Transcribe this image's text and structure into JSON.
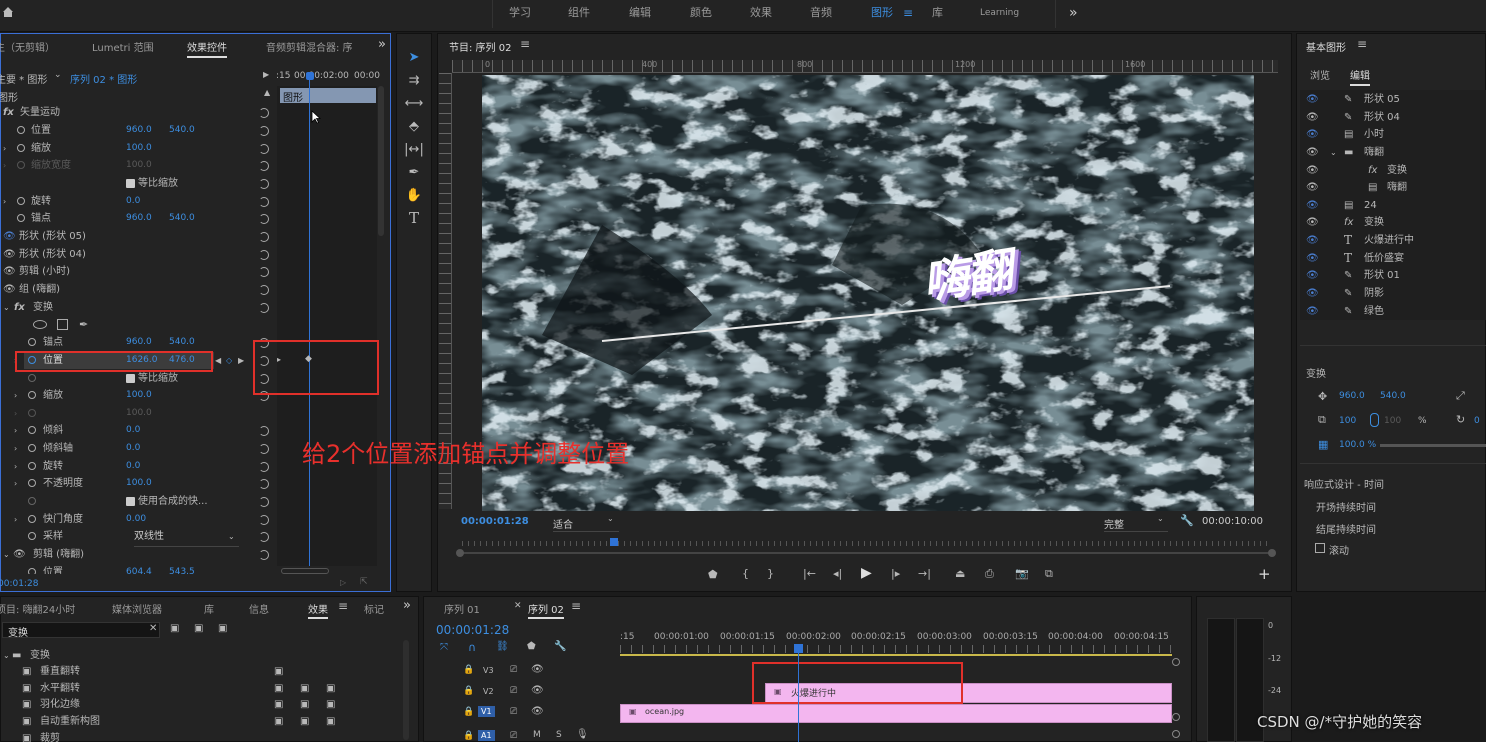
{
  "workspaces": {
    "items": [
      "学习",
      "组件",
      "编辑",
      "颜色",
      "效果",
      "音频",
      "图形",
      "库",
      "Learning"
    ],
    "active": "图形",
    "menu_icon": "hamburger-icon",
    "more": "»"
  },
  "effect_controls": {
    "tabs": [
      "主（无剪辑）",
      "Lumetri 范围",
      "效果控件",
      "音频剪辑混合器: 序"
    ],
    "active_tab": "效果控件",
    "source_label": "主要 * 图形",
    "sequence_label": "序列 02 * 图形",
    "timecode_start": ":15",
    "timecode_mid": "00:00:02:00",
    "timecode_end": "00:00",
    "clip_label": "图形",
    "section_label": "图形",
    "rows": [
      {
        "label": "矢量运动",
        "v1": "",
        "v2": ""
      },
      {
        "label": "位置",
        "v1": "960.0",
        "v2": "540.0"
      },
      {
        "label": "缩放",
        "v1": "100.0",
        "v2": ""
      },
      {
        "label": "缩放宽度",
        "v1": "100.0",
        "v2": ""
      },
      {
        "label": "等比缩放",
        "v1": "",
        "v2": ""
      },
      {
        "label": "旋转",
        "v1": "0.0",
        "v2": ""
      },
      {
        "label": "锚点",
        "v1": "960.0",
        "v2": "540.0"
      },
      {
        "label": "形状 (形状 05)",
        "v1": "",
        "v2": ""
      },
      {
        "label": "形状 (形状 04)",
        "v1": "",
        "v2": ""
      },
      {
        "label": "剪辑 (小时)",
        "v1": "",
        "v2": ""
      },
      {
        "label": "组 (嗨翻)",
        "v1": "",
        "v2": ""
      },
      {
        "label": "变换",
        "v1": "",
        "v2": ""
      },
      {
        "label": "",
        "v1": "",
        "v2": ""
      },
      {
        "label": "锚点",
        "v1": "960.0",
        "v2": "540.0"
      },
      {
        "label": "位置",
        "v1": "1626.0",
        "v2": "476.0"
      },
      {
        "label": "等比缩放",
        "v1": "",
        "v2": ""
      },
      {
        "label": "缩放",
        "v1": "100.0",
        "v2": ""
      },
      {
        "label": "",
        "v1": "100.0",
        "v2": ""
      },
      {
        "label": "倾斜",
        "v1": "0.0",
        "v2": ""
      },
      {
        "label": "倾斜轴",
        "v1": "0.0",
        "v2": ""
      },
      {
        "label": "旋转",
        "v1": "0.0",
        "v2": ""
      },
      {
        "label": "不透明度",
        "v1": "100.0",
        "v2": ""
      },
      {
        "label": "使用合成的快...",
        "v1": "",
        "v2": ""
      },
      {
        "label": "快门角度",
        "v1": "0.00",
        "v2": ""
      },
      {
        "label": "采样",
        "v1": "双线性",
        "v2": ""
      },
      {
        "label": "剪辑 (嗨翻)",
        "v1": "",
        "v2": ""
      },
      {
        "label": "位置",
        "v1": "604.4",
        "v2": "543.5"
      }
    ],
    "footer_timecode": "00:01:28"
  },
  "program": {
    "title": "节目: 序列 02",
    "menu_icon": "hamburger-icon",
    "ruler_ticks": [
      "0",
      "400",
      "800",
      "1200",
      "1600"
    ],
    "title_text": "嗨翻",
    "timecode": "00:00:01:28",
    "fit": "适合",
    "quality": "完整",
    "duration": "00:00:10:00"
  },
  "annotation": "给2个位置添加锚点并调整位置",
  "essential_graphics": {
    "title": "基本图形",
    "tabs": [
      "浏览",
      "编辑"
    ],
    "active_tab": "编辑",
    "layers": [
      "形状 05",
      "形状 04",
      "小时",
      "嗨翻",
      "变换",
      "嗨翻",
      "24",
      "变换",
      "火爆进行中",
      "低价盛宴",
      "形状 01",
      "阴影",
      "绿色"
    ],
    "transform_label": "变换",
    "pos_x": "960.0",
    "pos_y": "540.0",
    "scale": "100",
    "scale2": "100",
    "pct": "%",
    "rot": "0",
    "opacity": "100.0 %",
    "responsive_label": "响应式设计 - 时间",
    "intro": "开场持续时间",
    "outro": "结尾持续时间",
    "roll": "滚动"
  },
  "project": {
    "tabs": [
      "项目: 嗨翻24小时",
      "媒体浏览器",
      "库",
      "信息",
      "效果",
      "标记"
    ],
    "active_tab": "效果",
    "search_value": "变换",
    "folder": "变换",
    "items": [
      "垂直翻转",
      "水平翻转",
      "羽化边缘",
      "自动重新构图",
      "裁剪"
    ]
  },
  "timeline": {
    "tabs": [
      "序列 01",
      "序列 02"
    ],
    "active_tab": "序列 02",
    "timecode": "00:00:01:28",
    "ticks": [
      ":15",
      "00:00:01:00",
      "00:00:01:15",
      "00:00:02:00",
      "00:00:02:15",
      "00:00:03:00",
      "00:00:03:15",
      "00:00:04:00",
      "00:00:04:15"
    ],
    "tracks": [
      "V3",
      "V2",
      "V1",
      "A1"
    ],
    "clip_v2": "火爆进行中",
    "clip_v1": "ocean.jpg"
  },
  "meter": {
    "labels": [
      "0",
      "-12",
      "-24"
    ]
  },
  "watermark": "CSDN @/*守护她的笑容"
}
